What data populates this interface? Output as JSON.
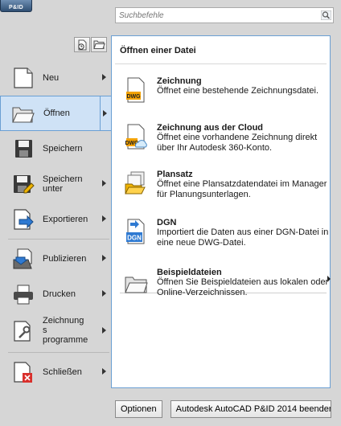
{
  "app_badge": "P&ID",
  "search": {
    "placeholder": "Suchbefehle"
  },
  "top_buttons": [
    {
      "icon": "recent-documents-icon"
    },
    {
      "icon": "open-documents-icon"
    }
  ],
  "menu": {
    "items": [
      {
        "label": "Neu",
        "icon": "new-document-icon",
        "has_submenu": true
      },
      {
        "label": "Öffnen",
        "icon": "open-folder-icon",
        "has_submenu": true,
        "active": true
      },
      {
        "label": "Speichern",
        "icon": "save-icon",
        "has_submenu": false
      },
      {
        "label": "Speichern\nunter",
        "icon": "save-as-icon",
        "has_submenu": true
      },
      {
        "label": "Exportieren",
        "icon": "export-icon",
        "has_submenu": true
      },
      {
        "label": "Publizieren",
        "icon": "publish-icon",
        "has_submenu": true
      },
      {
        "label": "Drucken",
        "icon": "print-icon",
        "has_submenu": true
      },
      {
        "label": "Zeichnung\ns\nprogramme",
        "icon": "drawing-utilities-icon",
        "has_submenu": true
      },
      {
        "label": "Schließen",
        "icon": "close-document-icon",
        "has_submenu": true
      }
    ]
  },
  "panel": {
    "title": "Öffnen einer Datei",
    "entries": [
      {
        "title": "Zeichnung",
        "description": "Öffnet eine bestehende Zeichnungsdatei.",
        "icon": "dwg-file-icon",
        "icon_text": "DWG"
      },
      {
        "title": "Zeichnung aus der Cloud",
        "description": "Öffnet eine vorhandene Zeichnung direkt über Ihr Autodesk 360-Konto.",
        "icon": "dwg-cloud-icon",
        "icon_text": "DWG"
      },
      {
        "title": "Plansatz",
        "description": "Öffnet eine Plansatzdatendatei im Manager für Planungsunterlagen.",
        "icon": "sheet-set-icon"
      },
      {
        "title": "DGN",
        "description": "Importiert die Daten aus einer DGN-Datei in eine neue DWG-Datei.",
        "icon": "dgn-import-icon",
        "icon_text": "DGN"
      },
      {
        "title": "Beispieldateien",
        "description": "Öffnen Sie Beispieldateien aus lokalen oder Online-Verzeichnissen.",
        "icon": "sample-files-folder-icon",
        "has_submenu": true
      }
    ]
  },
  "bottom": {
    "options_label": "Optionen",
    "exit_label": "Autodesk AutoCAD P&ID 2014 beenden"
  },
  "colors": {
    "active_bg": "#cfe2f6",
    "active_border": "#6a9fd3",
    "menu_bg": "#d6d6d6",
    "panel_bg": "#ffffff"
  }
}
